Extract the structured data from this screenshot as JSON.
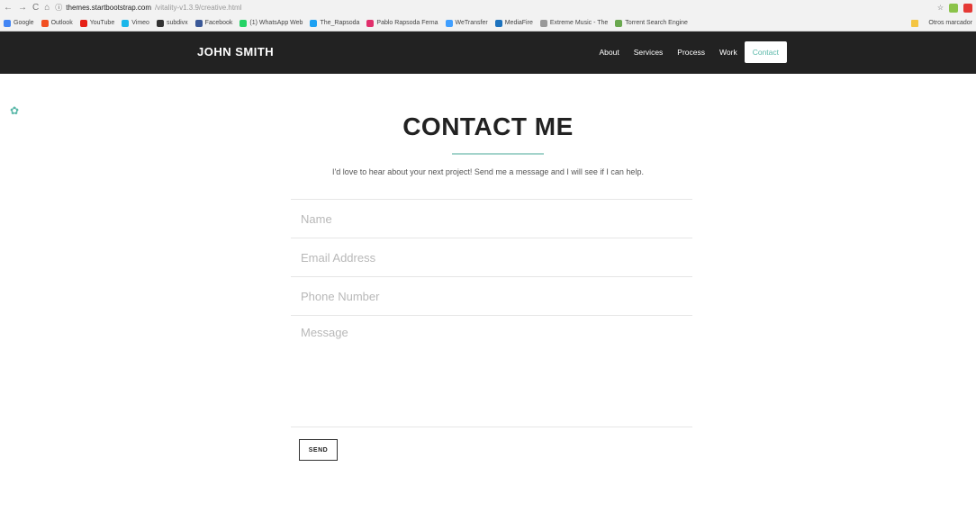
{
  "browser": {
    "url_host": "themes.startbootstrap.com",
    "url_path": "/vitality-v1.3.9/creative.html",
    "bookmarks": [
      {
        "label": "Google",
        "color": "#4285f4"
      },
      {
        "label": "Outlook",
        "color": "#f25022"
      },
      {
        "label": "YouTube",
        "color": "#e62117"
      },
      {
        "label": "Vimeo",
        "color": "#1ab7ea"
      },
      {
        "label": "subdivx",
        "color": "#333333"
      },
      {
        "label": "Facebook",
        "color": "#3b5998"
      },
      {
        "label": "(1) WhatsApp Web",
        "color": "#25d366"
      },
      {
        "label": "The_Rapsoda",
        "color": "#1da1f2"
      },
      {
        "label": "Pablo Rapsoda Ferna",
        "color": "#e1306c"
      },
      {
        "label": "WeTransfer",
        "color": "#409fff"
      },
      {
        "label": "MediaFire",
        "color": "#1e73be"
      },
      {
        "label": "Extreme Music - The",
        "color": "#999999"
      },
      {
        "label": "Torrent Search Engine",
        "color": "#6aa84f"
      }
    ],
    "other_bookmarks": "Otros marcador"
  },
  "navbar": {
    "brand": "JOHN SMITH",
    "items": [
      "About",
      "Services",
      "Process",
      "Work",
      "Contact"
    ],
    "active": "Contact"
  },
  "section": {
    "title": "CONTACT ME",
    "lead": "I'd love to hear about your next project! Send me a message and I will see if I can help.",
    "form": {
      "name_placeholder": "Name",
      "email_placeholder": "Email Address",
      "phone_placeholder": "Phone Number",
      "message_placeholder": "Message",
      "send_label": "SEND"
    }
  },
  "colors": {
    "accent": "#5ab8a9",
    "navbar_bg": "#222222"
  }
}
